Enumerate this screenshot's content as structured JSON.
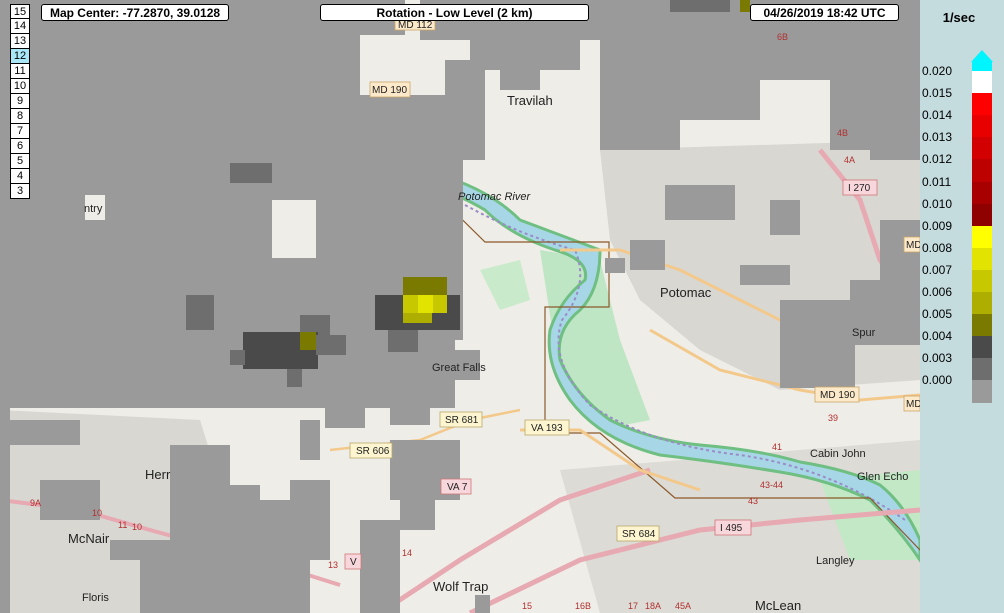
{
  "header": {
    "map_center_label": "Map Center: -77.2870, 39.0128",
    "product_label": "Rotation - Low Level (2 km)",
    "timestamp_label": "04/26/2019   18:42 UTC"
  },
  "elevations": {
    "items": [
      "15",
      "14",
      "13",
      "12",
      "11",
      "10",
      "9",
      "8",
      "7",
      "6",
      "5",
      "4",
      "3"
    ],
    "selected": "12"
  },
  "legend": {
    "unit": "1/sec",
    "levels": [
      {
        "label": "0.020",
        "color": "#ffffff"
      },
      {
        "label": "0.015",
        "color": "#ff0000"
      },
      {
        "label": "0.014",
        "color": "#e80000"
      },
      {
        "label": "0.013",
        "color": "#d20000"
      },
      {
        "label": "0.012",
        "color": "#bd0000"
      },
      {
        "label": "0.011",
        "color": "#a80000"
      },
      {
        "label": "0.010",
        "color": "#8f0000"
      },
      {
        "label": "0.009",
        "color": "#ffff00"
      },
      {
        "label": "0.008",
        "color": "#e3e300"
      },
      {
        "label": "0.007",
        "color": "#c8c800"
      },
      {
        "label": "0.006",
        "color": "#aeae00"
      },
      {
        "label": "0.005",
        "color": "#7a7a00"
      },
      {
        "label": "0.004",
        "color": "#4a4a4a"
      },
      {
        "label": "0.003",
        "color": "#6e6e6e"
      },
      {
        "label": "0.000",
        "color": "#9a9a9a"
      }
    ]
  },
  "map": {
    "places": [
      "Travilah",
      "Potomac",
      "Great Falls",
      "Cabin John",
      "Glen Echo",
      "McNair",
      "Herr",
      "Wolf Trap",
      "McLean",
      "Langley",
      "Floris",
      "ntry",
      "Spur"
    ],
    "roads": [
      "I 270",
      "MD 190",
      "MD 190",
      "VA 193",
      "SR 681",
      "SR 606",
      "VA 7",
      "SR 684",
      "I 495",
      "MD 112",
      "MD",
      "MD",
      "V"
    ],
    "river": "Potomac River",
    "exits": [
      "6B",
      "4B",
      "4A",
      "41",
      "39",
      "43-44",
      "43",
      "10",
      "11",
      "10",
      "14",
      "13",
      "15",
      "16B",
      "17",
      "18A",
      "45A",
      "9A"
    ]
  }
}
